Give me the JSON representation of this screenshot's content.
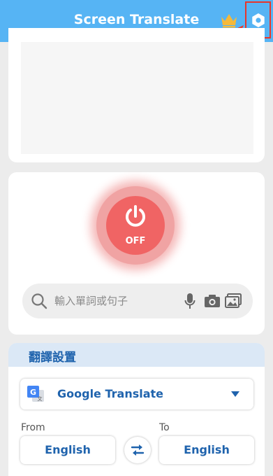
{
  "header": {
    "title": "Screen Translate",
    "crown_icon": "crown-icon",
    "settings_icon": "gear-icon",
    "brand_color": "#56b4f4"
  },
  "power": {
    "state_label": "OFF",
    "icon": "power-icon",
    "color": "#f06464"
  },
  "search": {
    "placeholder": "輸入單詞或句子",
    "icons": [
      "search-icon",
      "microphone-icon",
      "camera-icon",
      "image-icon"
    ]
  },
  "settings": {
    "section_title": "翻譯設置",
    "engine": {
      "label": "Google Translate",
      "icon": "google-translate-icon"
    },
    "from_label": "From",
    "to_label": "To",
    "source_language": "English",
    "target_language": "English",
    "swap_icon": "swap-icon"
  },
  "annotation": {
    "highlight_color": "#e8352a"
  }
}
